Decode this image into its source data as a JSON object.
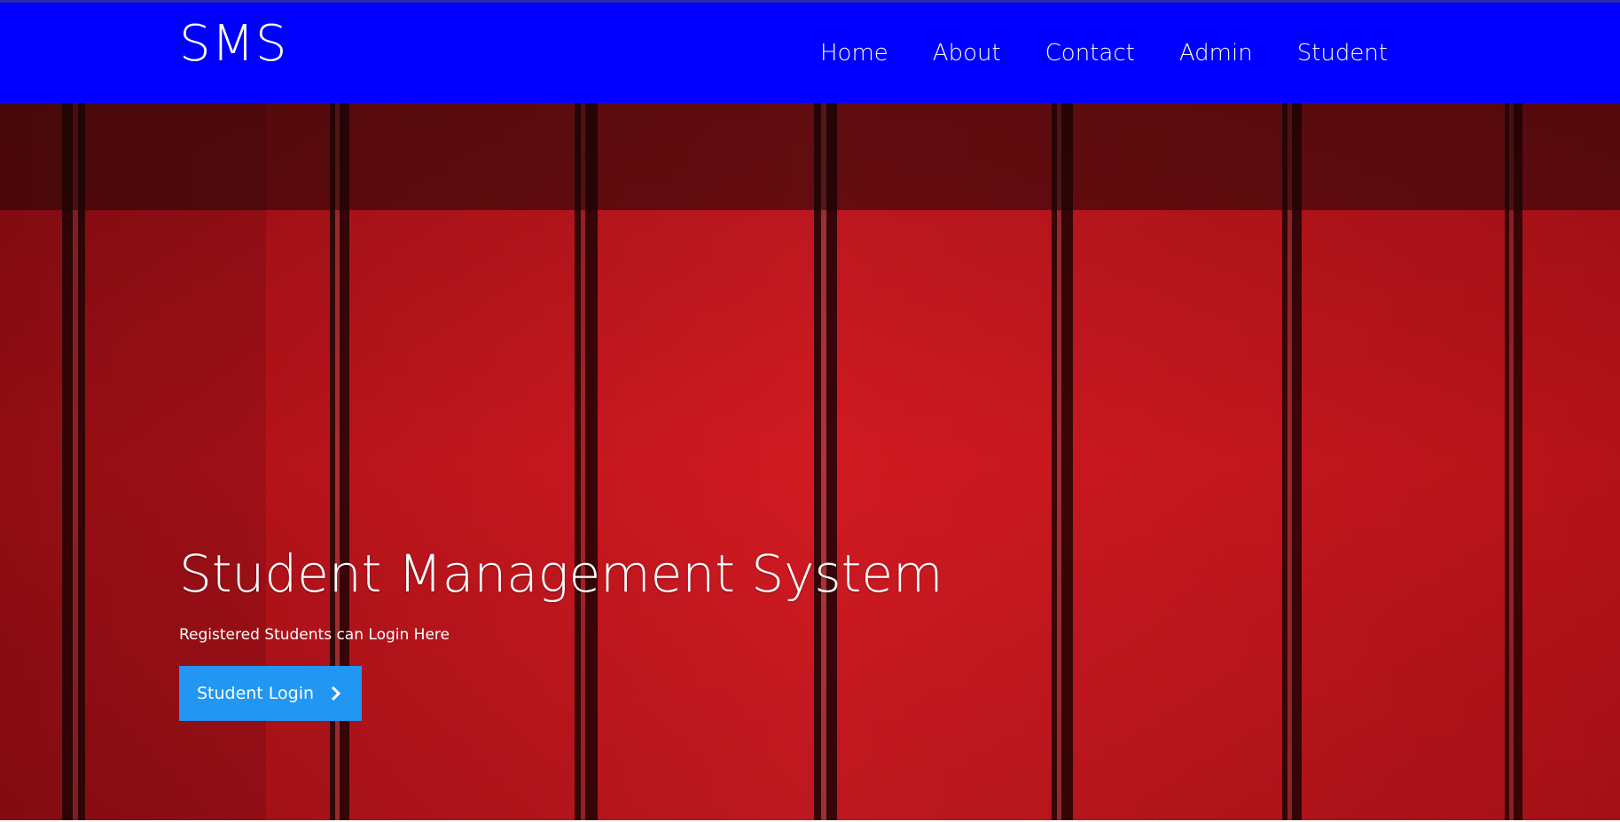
{
  "header": {
    "brand": "SMS",
    "nav": [
      "Home",
      "About",
      "Contact",
      "Admin",
      "Student"
    ]
  },
  "hero": {
    "title": "Student Management System",
    "subtitle": "Registered Students can Login Here",
    "button_label": "Student Login",
    "button_icon": "chevron-right-icon"
  },
  "colors": {
    "navbar": "#0000fe",
    "hero_background": "#c5141b",
    "button": "#2196f3",
    "text": "#ffffff"
  }
}
